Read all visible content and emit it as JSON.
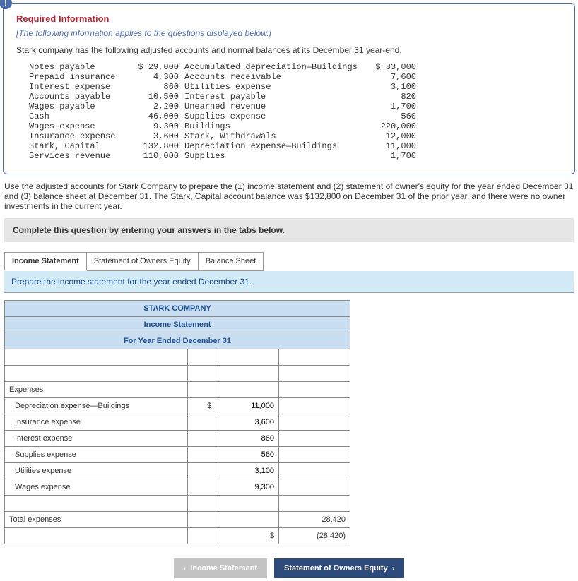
{
  "badge": "!",
  "required_info_title": "Required Information",
  "italic_note": "[The following information applies to the questions displayed below.]",
  "intro_line": "Stark company has the following adjusted accounts and normal balances at its December 31 year-end.",
  "accounts_col1": [
    {
      "label": "Notes payable",
      "value": "$ 29,000"
    },
    {
      "label": "Prepaid insurance",
      "value": "4,300"
    },
    {
      "label": "Interest expense",
      "value": "860"
    },
    {
      "label": "Accounts payable",
      "value": "10,500"
    },
    {
      "label": "Wages payable",
      "value": "2,200"
    },
    {
      "label": "Cash",
      "value": "46,000"
    },
    {
      "label": "Wages expense",
      "value": "9,300"
    },
    {
      "label": "Insurance expense",
      "value": "3,600"
    },
    {
      "label": "Stark, Capital",
      "value": "132,800"
    },
    {
      "label": "Services revenue",
      "value": "110,000"
    }
  ],
  "accounts_col2": [
    {
      "label": "Accumulated depreciation—Buildings",
      "value": "$ 33,000"
    },
    {
      "label": "Accounts receivable",
      "value": "7,600"
    },
    {
      "label": "Utilities expense",
      "value": "3,100"
    },
    {
      "label": "Interest payable",
      "value": "820"
    },
    {
      "label": "Unearned revenue",
      "value": "1,700"
    },
    {
      "label": "Supplies expense",
      "value": "560"
    },
    {
      "label": "Buildings",
      "value": "220,000"
    },
    {
      "label": "Stark, Withdrawals",
      "value": "12,000"
    },
    {
      "label": "Depreciation expense—Buildings",
      "value": "11,000"
    },
    {
      "label": "Supplies",
      "value": "1,700"
    }
  ],
  "mid_paragraph": "Use the adjusted accounts for Stark Company to prepare the (1) income statement and (2) statement of owner's equity for the year ended December 31 and (3) balance sheet at December 31. The Stark, Capital account balance was $132,800 on December 31 of the prior year, and there were no owner investments in the current year.",
  "instruction_bar": "Complete this question by entering your answers in the tabs below.",
  "tabs": {
    "income": "Income Statement",
    "equity": "Statement of Owners Equity",
    "balance": "Balance Sheet"
  },
  "prepare_line": "Prepare the income statement for the year ended December 31.",
  "sheet_header": {
    "company": "STARK COMPANY",
    "report": "Income Statement",
    "period": "For Year Ended December 31"
  },
  "rows": {
    "expenses_label": "Expenses",
    "exp1": {
      "label": "Depreciation expense—Buildings",
      "prefix": "$",
      "val": "11,000"
    },
    "exp2": {
      "label": "Insurance expense",
      "val": "3,600"
    },
    "exp3": {
      "label": "Interest expense",
      "val": "860"
    },
    "exp4": {
      "label": "Supplies expense",
      "val": "560"
    },
    "exp5": {
      "label": "Utilities expense",
      "val": "3,100"
    },
    "exp6": {
      "label": "Wages expense",
      "val": "9,300"
    },
    "total_label": "Total expenses",
    "total_val": "28,420",
    "net_prefix": "$",
    "net_val": "(28,420)"
  },
  "nav": {
    "prev": "Income Statement",
    "next": "Statement of Owners Equity"
  }
}
